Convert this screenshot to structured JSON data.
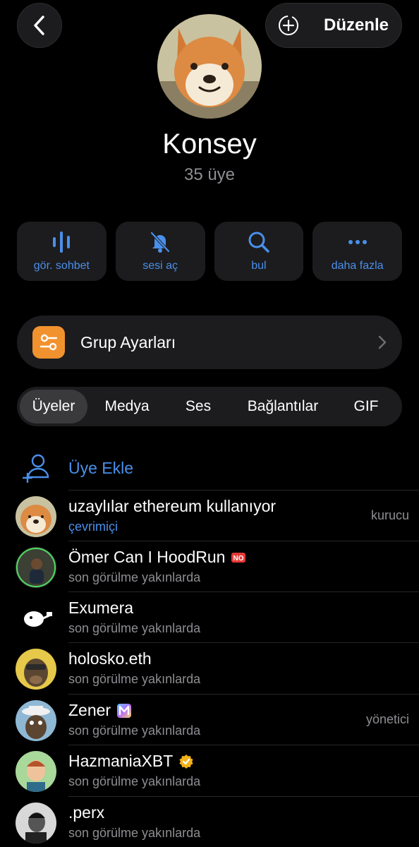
{
  "header": {
    "edit_label": "Düzenle"
  },
  "group": {
    "name": "Konsey",
    "members_count": "35 üye"
  },
  "actions": [
    {
      "label": "gör. sohbet",
      "icon": "voice-chat-icon"
    },
    {
      "label": "sesi aç",
      "icon": "bell-muted-icon"
    },
    {
      "label": "bul",
      "icon": "search-icon"
    },
    {
      "label": "daha fazla",
      "icon": "more-icon"
    }
  ],
  "settings": {
    "label": "Grup Ayarları"
  },
  "tabs": [
    {
      "label": "Üyeler",
      "active": true
    },
    {
      "label": "Medya"
    },
    {
      "label": "Ses"
    },
    {
      "label": "Bağlantılar"
    },
    {
      "label": "GIF"
    }
  ],
  "add_member": {
    "label": "Üye Ekle"
  },
  "members": [
    {
      "name": "uzaylılar ethereum kullanıyor",
      "status": "çevrimiçi",
      "role": "kurucu"
    },
    {
      "name": "Ömer Can I HoodRun",
      "status": "son görülme yakınlarda",
      "role": ""
    },
    {
      "name": "Exumera",
      "status": "son görülme yakınlarda",
      "role": ""
    },
    {
      "name": "holosko.eth",
      "status": "son görülme yakınlarda",
      "role": ""
    },
    {
      "name": "Zener",
      "status": "son görülme yakınlarda",
      "role": "yönetici"
    },
    {
      "name": "HazmaniaXBT",
      "status": "son görülme yakınlarda",
      "role": ""
    },
    {
      "name": ".perx",
      "status": "son görülme yakınlarda",
      "role": ""
    }
  ],
  "colors": {
    "accent": "#4a8fea",
    "background": "#000000",
    "card": "#1c1c1e",
    "settings_icon": "#f2922f"
  }
}
